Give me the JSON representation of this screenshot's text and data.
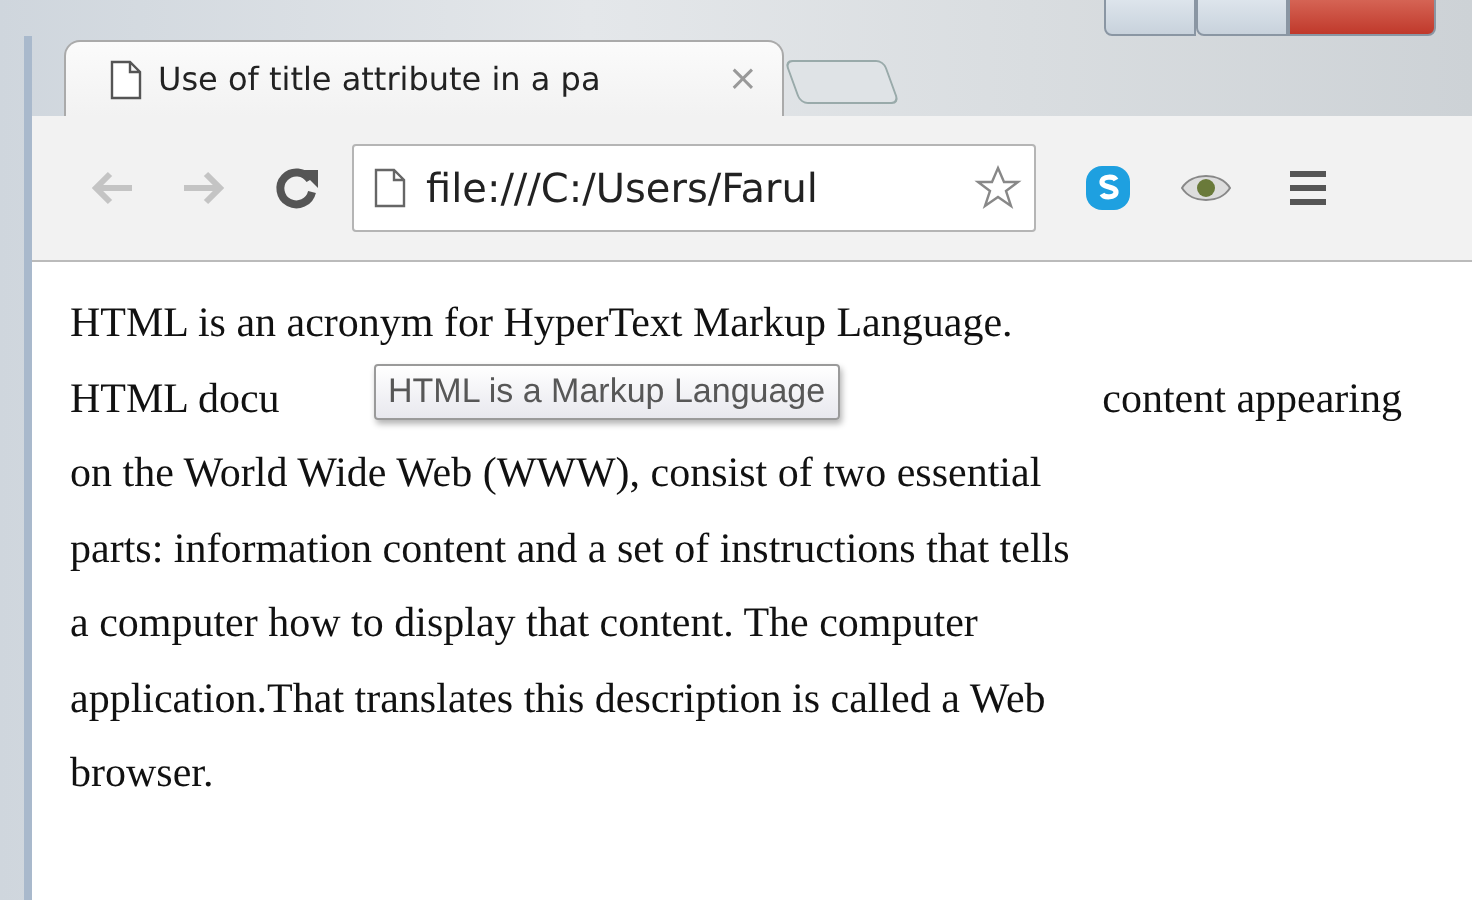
{
  "tab": {
    "title": "Use of title attribute in a pa",
    "close": "×",
    "selected": true
  },
  "toolbar": {
    "back_disabled": true,
    "forward_disabled": true,
    "address": "file:///C:/Users/Farul"
  },
  "content": {
    "lines": [
      {
        "kind": "full",
        "text": "HTML is an acronym for HyperText Markup Language."
      },
      {
        "kind": "split",
        "left": "HTML docu",
        "right": "content appearing"
      },
      {
        "kind": "full",
        "text": "on the World Wide Web (WWW), consist of two essential"
      },
      {
        "kind": "full",
        "text": "parts: information content and a set of instructions that tells"
      },
      {
        "kind": "full",
        "text": "a computer how to display that content. The computer"
      },
      {
        "kind": "full",
        "text": "application.That translates this description is called a Web"
      },
      {
        "kind": "full",
        "text": "browser."
      }
    ]
  },
  "tooltip": {
    "text": "HTML is a Markup Language"
  }
}
